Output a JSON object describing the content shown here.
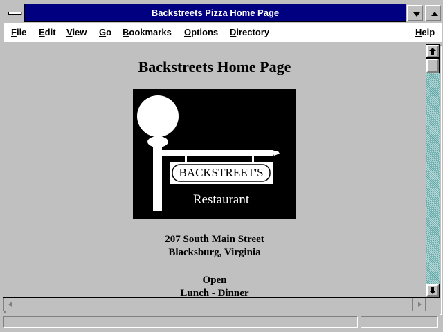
{
  "window": {
    "title": "Backstreets Pizza Home Page"
  },
  "menubar": {
    "items": [
      {
        "label": "File",
        "accel": "F",
        "rest": "ile"
      },
      {
        "label": "Edit",
        "accel": "E",
        "rest": "dit"
      },
      {
        "label": "View",
        "accel": "V",
        "rest": "iew"
      },
      {
        "label": "Go",
        "accel": "G",
        "rest": "o"
      },
      {
        "label": "Bookmarks",
        "accel": "B",
        "rest": "ookmarks"
      },
      {
        "label": "Options",
        "accel": "O",
        "rest": "ptions"
      },
      {
        "label": "Directory",
        "accel": "D",
        "rest": "irectory"
      },
      {
        "label": "Help",
        "accel": "H",
        "rest": "elp"
      }
    ]
  },
  "page": {
    "heading": "Backstreets Home Page",
    "logo": {
      "sign_text": "BACKSTREET'S",
      "caption": "Restaurant"
    },
    "address_line1": "207 South Main Street",
    "address_line2": "Blacksburg, Virginia",
    "hours_title": "Open",
    "hours_detail": "Lunch - Dinner"
  },
  "statusbar": {
    "text": ""
  },
  "colors": {
    "titlebar": "#000080",
    "chrome": "#c0c0c0",
    "desktop": "#008080"
  }
}
